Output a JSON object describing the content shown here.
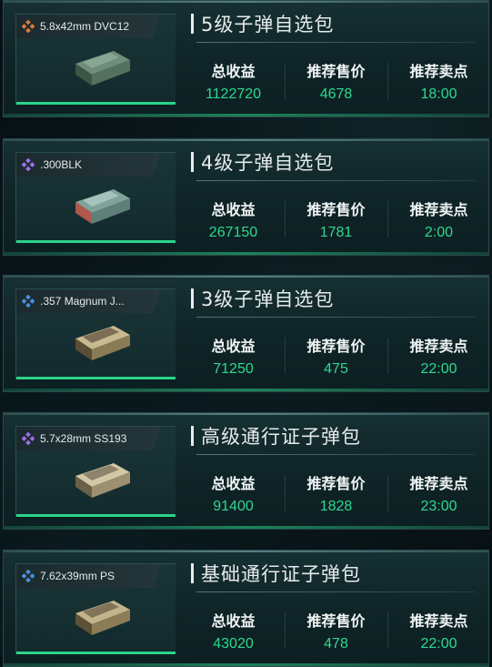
{
  "colors": {
    "accent_green": "#2fd88f",
    "tier_orange": "#e07b3a",
    "tier_purple": "#a070e8",
    "tier_blue": "#4a90e0"
  },
  "labels": {
    "total_income": "总收益",
    "recommended_price": "推荐售价",
    "recommended_time": "推荐卖点"
  },
  "cards": [
    {
      "ammo_name": "5.8x42mm DVC12",
      "tier_icon": "orange-diamond-icon",
      "title": "5级子弹自选包",
      "total_income": "1122720",
      "recommended_price": "4678",
      "recommended_time": "18:00"
    },
    {
      "ammo_name": ".300BLK",
      "tier_icon": "purple-diamond-icon",
      "title": "4级子弹自选包",
      "total_income": "267150",
      "recommended_price": "1781",
      "recommended_time": "2:00"
    },
    {
      "ammo_name": ".357 Magnum J...",
      "tier_icon": "blue-diamond-icon",
      "title": "3级子弹自选包",
      "total_income": "71250",
      "recommended_price": "475",
      "recommended_time": "22:00"
    },
    {
      "ammo_name": "5.7x28mm SS193",
      "tier_icon": "purple-diamond-icon",
      "title": "高级通行证子弹包",
      "total_income": "91400",
      "recommended_price": "1828",
      "recommended_time": "23:00"
    },
    {
      "ammo_name": "7.62x39mm PS",
      "tier_icon": "blue-diamond-icon",
      "title": "基础通行证子弹包",
      "total_income": "43020",
      "recommended_price": "478",
      "recommended_time": "22:00"
    }
  ]
}
